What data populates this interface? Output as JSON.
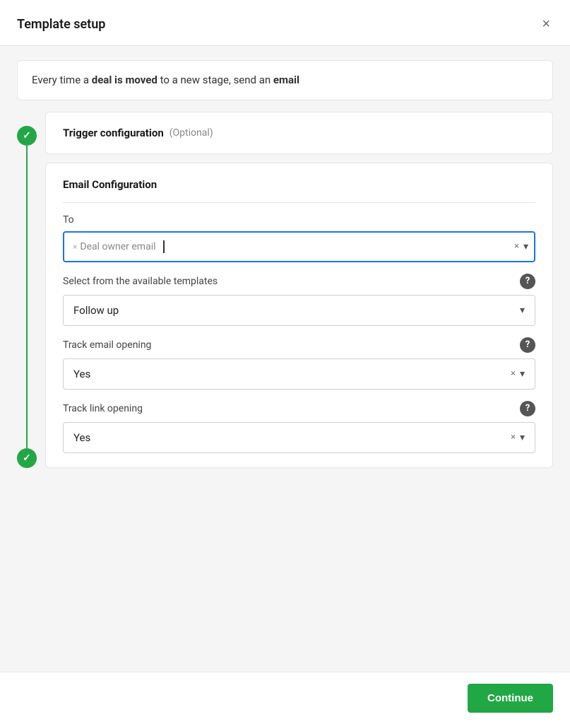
{
  "modal": {
    "title": "Template setup",
    "close_label": "×"
  },
  "summary": {
    "text_before": "Every time a ",
    "bold1": "deal is moved",
    "text_middle": " to a new stage, send an ",
    "bold2": "email"
  },
  "trigger": {
    "title": "Trigger configuration",
    "optional": "(Optional)"
  },
  "email_config": {
    "title": "Email Configuration",
    "to_label": "To",
    "tag_label": "Deal owner email",
    "tag_x": "×",
    "to_x": "×",
    "to_chevron": "▾",
    "templates_label": "Select from the available templates",
    "template_value": "Follow up",
    "template_chevron": "▾",
    "track_opening_label": "Track email opening",
    "track_opening_value": "Yes",
    "track_link_label": "Track link opening",
    "track_link_value": "Yes",
    "x_icon": "×",
    "chevron_icon": "▾",
    "help_icon": "?"
  },
  "footer": {
    "continue_label": "Continue"
  },
  "timeline": {
    "checkmark": "✓"
  }
}
